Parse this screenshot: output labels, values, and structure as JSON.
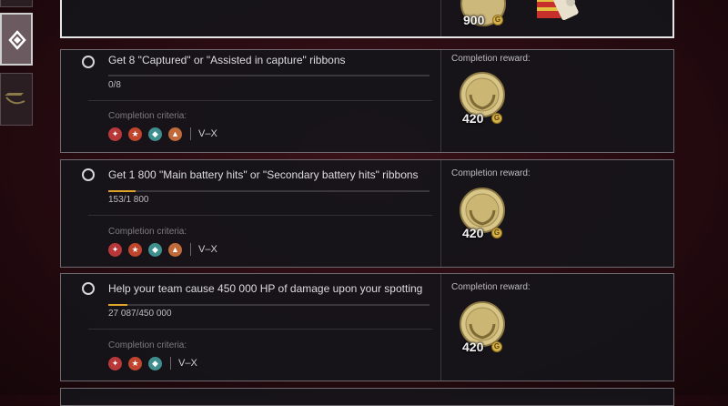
{
  "top_card": {
    "reward_amount": "900",
    "coin_glyph": "G"
  },
  "tasks": [
    {
      "title": "Get 8 \"Captured\" or \"Assisted in capture\" ribbons",
      "progress_text": "0/8",
      "progress": 0.0,
      "criteria_label": "Completion criteria:",
      "ship_classes": [
        "destroyer-icon",
        "cruiser-icon",
        "battleship-icon",
        "aircraft-carrier-icon"
      ],
      "tier_range": "V–X",
      "reward_label": "Completion reward:",
      "reward_amount": "420",
      "coin_glyph": "G"
    },
    {
      "title": "Get 1 800 \"Main battery hits\" or \"Secondary battery hits\" ribbons",
      "progress_text": "153/1 800",
      "progress": 0.085,
      "criteria_label": "Completion criteria:",
      "ship_classes": [
        "destroyer-icon",
        "cruiser-icon",
        "battleship-icon",
        "aircraft-carrier-icon"
      ],
      "tier_range": "V–X",
      "reward_label": "Completion reward:",
      "reward_amount": "420",
      "coin_glyph": "G"
    },
    {
      "title": "Help your team cause 450 000 HP of damage upon your spotting",
      "progress_text": "27 087/450 000",
      "progress": 0.06,
      "criteria_label": "Completion criteria:",
      "ship_classes": [
        "destroyer-icon",
        "cruiser-icon",
        "battleship-icon"
      ],
      "tier_range": "V–X",
      "reward_label": "Completion reward:",
      "reward_amount": "420",
      "coin_glyph": "G"
    }
  ],
  "colors": {
    "progress_fill": "#e0a32a",
    "destroyer": "#b8383a",
    "cruiser": "#c0452c",
    "battleship": "#3f8f8f",
    "aircraft_carrier": "#c06a3a"
  }
}
